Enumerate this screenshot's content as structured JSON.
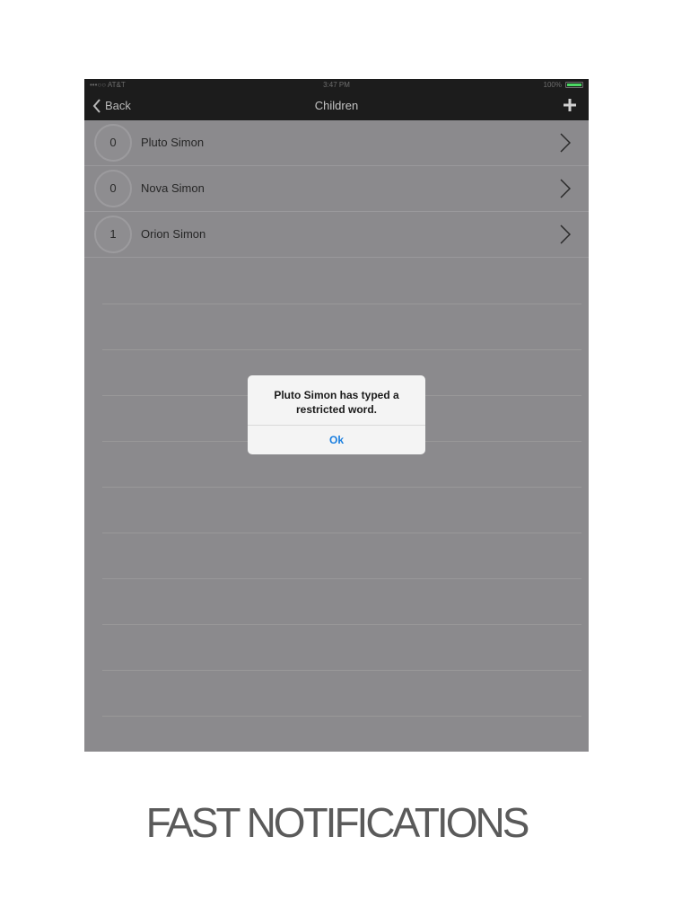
{
  "status_bar": {
    "carrier": "•••○○ AT&T",
    "time": "3:47 PM",
    "battery": "100%"
  },
  "nav": {
    "back_label": "Back",
    "title": "Children",
    "add_icon": "plus-icon",
    "back_icon": "chevron-left-icon"
  },
  "children": [
    {
      "count": "0",
      "name": "Pluto Simon"
    },
    {
      "count": "0",
      "name": "Nova Simon"
    },
    {
      "count": "1",
      "name": "Orion Simon"
    }
  ],
  "alert": {
    "message_line1": "Pluto Simon has typed a",
    "message_line2": "restricted word.",
    "ok_label": "Ok"
  },
  "caption": "FAST NOTIFICATIONS",
  "colors": {
    "nav_bg": "#1c1c1c",
    "list_bg": "#8b8a8d",
    "alert_button": "#1a7fe0"
  }
}
